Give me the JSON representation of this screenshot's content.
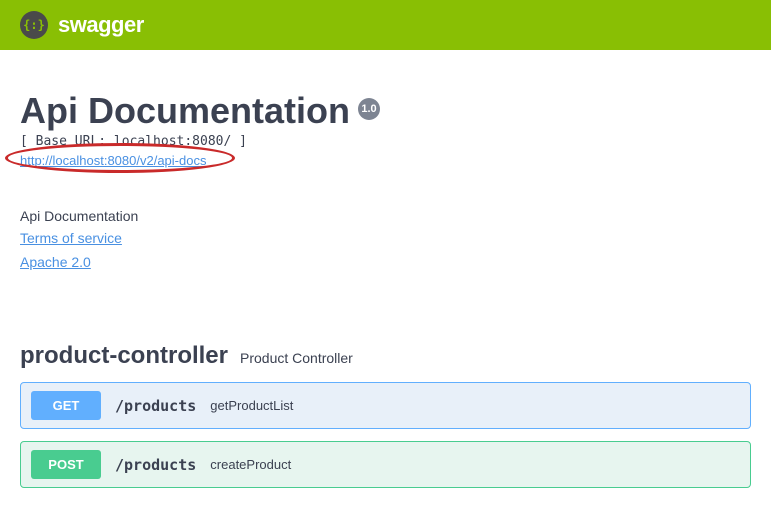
{
  "branding": {
    "name": "swagger"
  },
  "info": {
    "title": "Api Documentation",
    "version": "1.0",
    "base_url": "[ Base URL: localhost:8080/ ]",
    "api_docs_url": "http://localhost:8080/v2/api-docs",
    "description": "Api Documentation",
    "terms_label": "Terms of service",
    "license_label": "Apache 2.0"
  },
  "controller": {
    "name": "product-controller",
    "description": "Product Controller"
  },
  "operations": [
    {
      "method": "GET",
      "path": "/products",
      "summary": "getProductList"
    },
    {
      "method": "POST",
      "path": "/products",
      "summary": "createProduct"
    }
  ]
}
